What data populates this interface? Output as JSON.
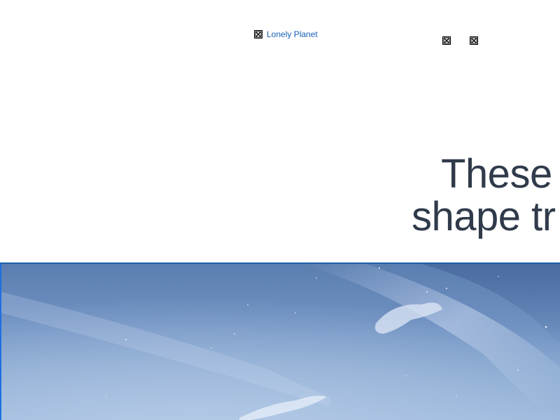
{
  "header": {
    "logo_label": "Lonely Planet",
    "icons": [
      "broken-image-icon",
      "broken-image-icon",
      "broken-image-icon"
    ]
  },
  "article": {
    "headline_line1": "These",
    "headline_line2": "shape tr"
  },
  "hero": {
    "description": "sky",
    "colors": {
      "sky_top": "#5b7eb0",
      "sky_bottom": "#97b6da",
      "accent_border": "#1c5fa8",
      "link": "#1a5fb4",
      "headline": "#2f3a4a"
    }
  }
}
